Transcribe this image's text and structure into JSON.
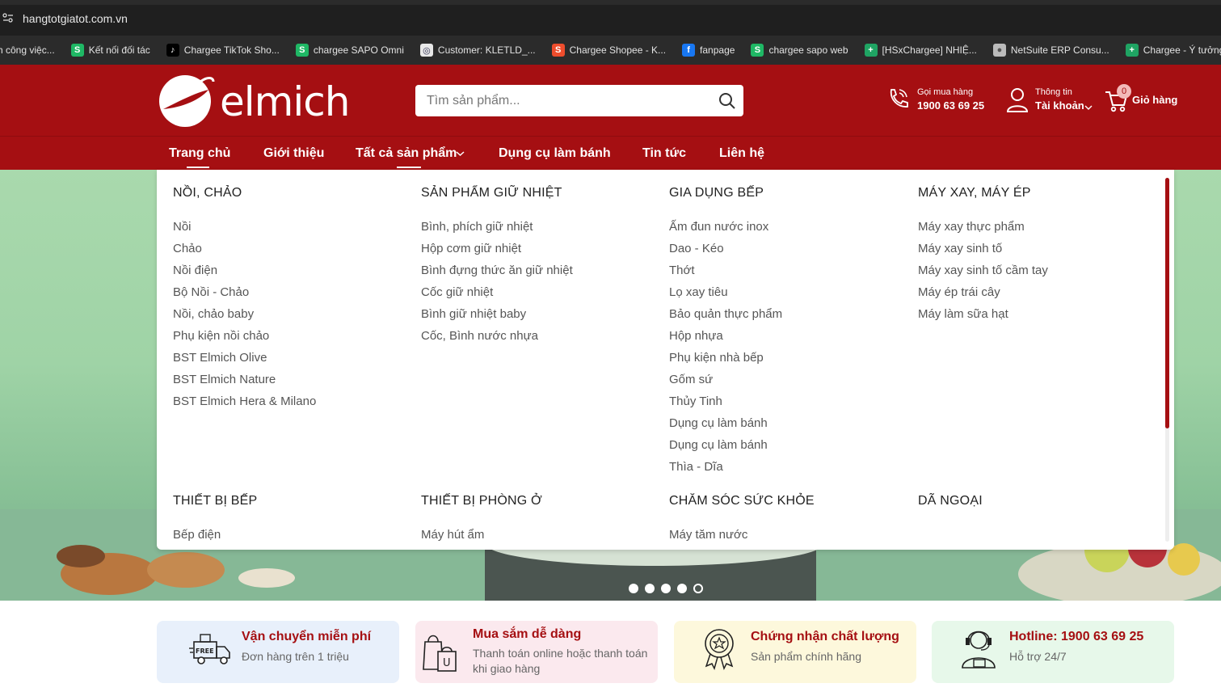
{
  "browser": {
    "url": "hangtotgiatot.com.vn",
    "bookmarks": [
      {
        "label": "h công việc...",
        "icon": "none"
      },
      {
        "label": "Kết nối đối tác",
        "icon": "sapo-icon"
      },
      {
        "label": "Chargee TikTok Sho...",
        "icon": "tiktok-icon"
      },
      {
        "label": "chargee SAPO Omni",
        "icon": "sapo-icon"
      },
      {
        "label": "Customer: KLETLD_...",
        "icon": "customer-icon"
      },
      {
        "label": "Chargee Shopee - K...",
        "icon": "shopee-icon"
      },
      {
        "label": "fanpage",
        "icon": "facebook-icon"
      },
      {
        "label": "chargee sapo web",
        "icon": "sapo-icon"
      },
      {
        "label": "[HSxChargee] NHIỆ...",
        "icon": "sheets-icon"
      },
      {
        "label": "NetSuite ERP Consu...",
        "icon": "globe-icon"
      },
      {
        "label": "Chargee - Ý tưởng...",
        "icon": "sheets-icon"
      }
    ]
  },
  "header": {
    "logo_text": "elmich",
    "search_placeholder": "Tìm sản phẩm...",
    "hotline_label": "Gọi mua hàng",
    "hotline_number": "1900 63 69 25",
    "account_label": "Thông tin",
    "account_value": "Tài khoản",
    "cart_count": "0",
    "cart_label": "Giỏ hàng"
  },
  "nav": {
    "items": [
      {
        "label": "Trang chủ"
      },
      {
        "label": "Giới thiệu"
      },
      {
        "label": "Tất cả sản phẩm"
      },
      {
        "label": "Dụng cụ làm bánh"
      },
      {
        "label": "Tin tức"
      },
      {
        "label": "Liên hệ"
      }
    ]
  },
  "mega_menu": {
    "columns": [
      {
        "title": "NỒI, CHẢO",
        "items": [
          "Nồi",
          "Chảo",
          "Nồi điện",
          "Bộ Nồi - Chảo",
          "Nồi, chảo baby",
          "Phụ kiện nồi chảo",
          "BST Elmich Olive",
          "BST Elmich Nature",
          "BST Elmich Hera & Milano"
        ]
      },
      {
        "title": "SẢN PHẨM GIỮ NHIỆT",
        "items": [
          "Bình, phích giữ nhiệt",
          "Hộp cơm giữ nhiệt",
          "Bình đựng thức ăn giữ nhiệt",
          "Cốc giữ nhiệt",
          "Bình giữ nhiệt baby",
          "Cốc, Bình nước nhựa"
        ]
      },
      {
        "title": "GIA DỤNG BẾP",
        "items": [
          "Ấm đun nước inox",
          "Dao - Kéo",
          "Thớt",
          "Lọ xay tiêu",
          "Bảo quản thực phẩm",
          "Hộp nhựa",
          "Phụ kiện nhà bếp",
          "Gốm sứ",
          "Thủy Tinh",
          "Dụng cụ làm bánh",
          "Dụng cụ làm bánh",
          "Thìa - Dĩa"
        ]
      },
      {
        "title": "MÁY XAY, MÁY ÉP",
        "items": [
          "Máy xay thực phẩm",
          "Máy xay sinh tố",
          "Máy xay sinh tố cầm tay",
          "Máy ép trái cây",
          "Máy làm sữa hạt"
        ]
      },
      {
        "title": "THIẾT BỊ BẾP",
        "items": [
          "Bếp điện"
        ]
      },
      {
        "title": "THIẾT BỊ PHÒNG Ở",
        "items": [
          "Máy hút ẩm"
        ]
      },
      {
        "title": "CHĂM SÓC SỨC KHỎE",
        "items": [
          "Máy tăm nước"
        ]
      },
      {
        "title": "DÃ NGOẠI",
        "items": []
      }
    ]
  },
  "banner": {
    "slides_total": 5,
    "active_slide": 5
  },
  "features": [
    {
      "title": "Vận chuyển miễn phí",
      "subtitle": "Đơn hàng trên 1 triệu",
      "icon": "free-shipping-truck-icon",
      "bg": "#e8f0fb"
    },
    {
      "title": "Mua sắm dễ dàng",
      "subtitle": "Thanh toán online hoặc thanh toán khi giao hàng",
      "icon": "shopping-bag-icon",
      "bg": "#fbe9ee"
    },
    {
      "title": "Chứng nhận chất lượng",
      "subtitle": "Sản phẩm chính hãng",
      "icon": "quality-badge-icon",
      "bg": "#fdf8dc"
    },
    {
      "title": "Hotline: 1900 63 69 25",
      "subtitle": "Hỗ trợ 24/7",
      "icon": "support-agent-icon",
      "bg": "#e7f8ea"
    }
  ],
  "colors": {
    "brand": "#a50f12",
    "text": "#222222",
    "muted": "#555555"
  }
}
